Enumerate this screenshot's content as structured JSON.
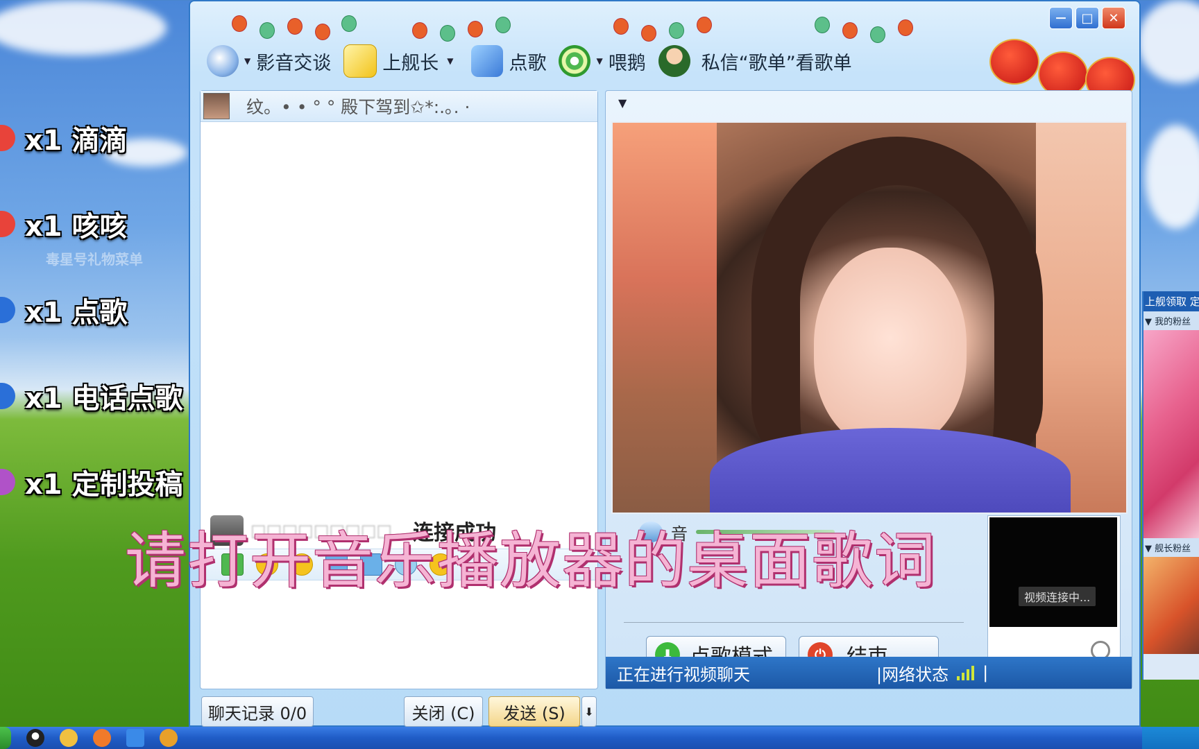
{
  "gifts": [
    {
      "label": "x1 滴滴",
      "color": "#e8433a"
    },
    {
      "label": "x1 咳咳",
      "color": "#e8433a"
    },
    {
      "label": "x1 点歌",
      "color": "#2a6fd8"
    },
    {
      "label": "x1 电话点歌",
      "color": "#2a6fd8"
    },
    {
      "label": "x1 定制投稿",
      "color": "#b052c8"
    }
  ],
  "watermark": "毒星号礼物菜单",
  "toolbar": {
    "video_chat": "影音交谈",
    "captain": "上舰长",
    "song": "点歌",
    "feed": "喂鹅",
    "private_msg": "私信“歌单”看歌单"
  },
  "window_buttons": {
    "minimize": "－",
    "restore": "□",
    "close": "✕"
  },
  "chat": {
    "nickname": "纹。• • ° °   殿下驾到✩*:.｡. ·",
    "blurred_text": "□□□□□□□□□",
    "connect_status": "连接成功",
    "history_label": "聊天记录 0/0",
    "close_button": "关闭 (C)",
    "send_button": "发送 (S)",
    "send_arrow": "⬇"
  },
  "video": {
    "dropdown": "▼",
    "volume_label": "音",
    "song_mode_button": "点歌模式",
    "end_button": "结束",
    "mini_status": "视频连接中...",
    "status_text": "正在进行视频聊天",
    "network_label": "|网络状态",
    "network_end": "|",
    "signal_level": 4
  },
  "subtitle": "请打开音乐播放器的桌面歌词",
  "side_window": {
    "title": "上舰领取 定",
    "sub1": "▼ 我的粉丝",
    "sub2": "▼ 舰长粉丝"
  },
  "taskbar_icons": [
    "qq-penguin",
    "chat",
    "browser",
    "renren",
    "tiger"
  ]
}
